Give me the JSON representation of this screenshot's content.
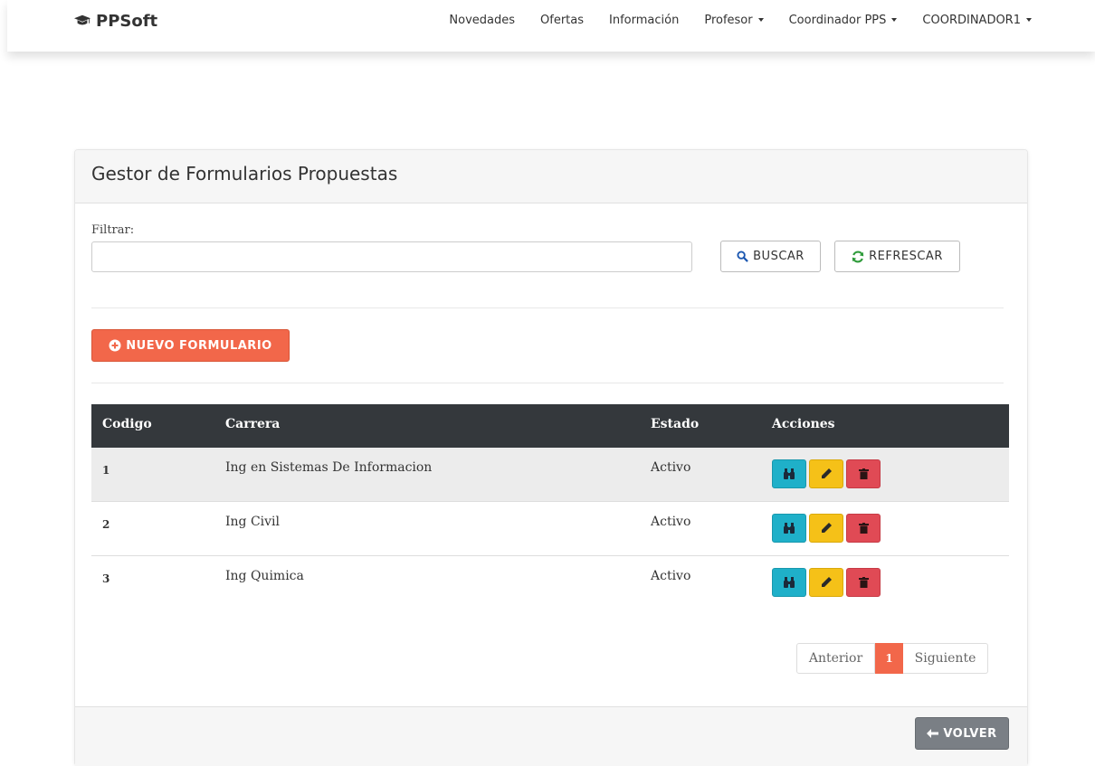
{
  "navbar": {
    "brand": "PPSoft",
    "items": [
      {
        "label": "Novedades",
        "dropdown": false
      },
      {
        "label": "Ofertas",
        "dropdown": false
      },
      {
        "label": "Información",
        "dropdown": false
      },
      {
        "label": "Profesor",
        "dropdown": true
      },
      {
        "label": "Coordinador PPS",
        "dropdown": true
      },
      {
        "label": "COORDINADOR1",
        "dropdown": true
      }
    ]
  },
  "panel": {
    "title": "Gestor de Formularios Propuestas",
    "filter_label": "Filtrar:",
    "filter_value": "",
    "buscar_label": "BUSCAR",
    "refrescar_label": "REFRESCAR",
    "nuevo_label": "NUEVO FORMULARIO"
  },
  "table": {
    "headers": {
      "codigo": "Codigo",
      "carrera": "Carrera",
      "estado": "Estado",
      "acciones": "Acciones"
    },
    "rows": [
      {
        "codigo": "1",
        "carrera": "Ing en Sistemas De Informacion",
        "estado": "Activo"
      },
      {
        "codigo": "2",
        "carrera": "Ing Civil",
        "estado": "Activo"
      },
      {
        "codigo": "3",
        "carrera": "Ing Quimica",
        "estado": "Activo"
      }
    ]
  },
  "pagination": {
    "prev": "Anterior",
    "current": "1",
    "next": "Siguiente"
  },
  "footer": {
    "volver_label": "VOLVER"
  },
  "colors": {
    "accent": "#f2674a",
    "view": "#1fb0c9",
    "edit": "#f5c118",
    "delete": "#e04a55",
    "table_header": "#34383c"
  },
  "icons": {
    "brand": "graduation-cap-icon",
    "buscar": "search-icon",
    "refrescar": "refresh-icon",
    "nuevo": "plus-circle-icon",
    "view": "binoculars-icon",
    "edit": "pencil-icon",
    "delete": "trash-icon",
    "volver": "arrow-left-icon"
  }
}
